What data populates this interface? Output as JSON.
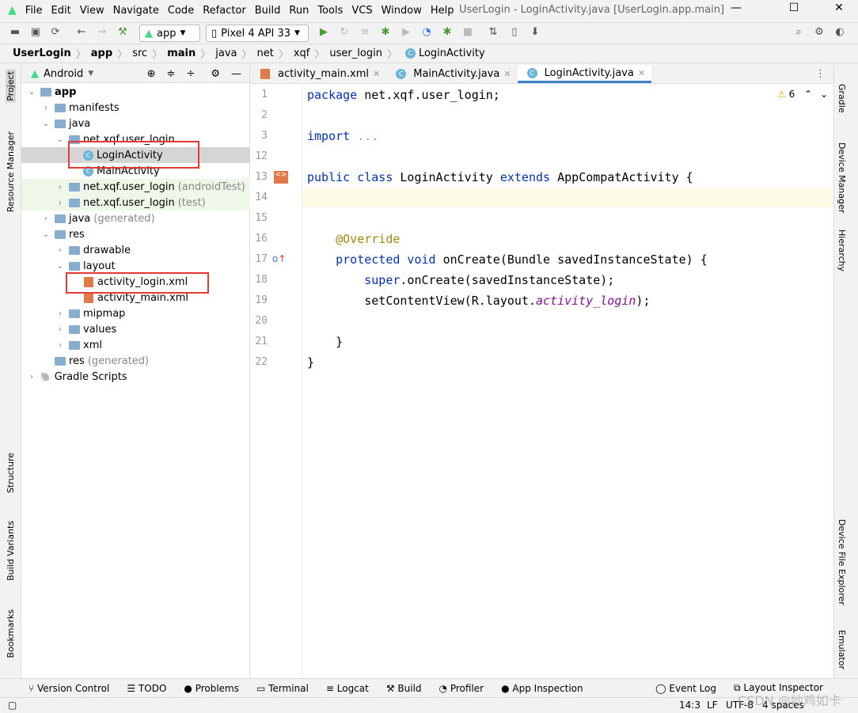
{
  "window": {
    "title": "UserLogin - LoginActivity.java [UserLogin.app.main]"
  },
  "menu": [
    "File",
    "Edit",
    "View",
    "Navigate",
    "Code",
    "Refactor",
    "Build",
    "Run",
    "Tools",
    "VCS",
    "Window",
    "Help"
  ],
  "toolbar": {
    "config": "app",
    "device": "Pixel 4 API 33"
  },
  "breadcrumb": [
    "UserLogin",
    "app",
    "src",
    "main",
    "java",
    "net",
    "xqf",
    "user_login",
    "LoginActivity"
  ],
  "project": {
    "view": "Android",
    "tree": [
      {
        "label": "app",
        "extra": ""
      },
      {
        "label": "manifests",
        "extra": ""
      },
      {
        "label": "java",
        "extra": ""
      },
      {
        "label": "net.xqf.user_login",
        "extra": ""
      },
      {
        "label": "LoginActivity",
        "extra": ""
      },
      {
        "label": "MainActivity",
        "extra": ""
      },
      {
        "label": "net.xqf.user_login",
        "extra": "(androidTest)"
      },
      {
        "label": "net.xqf.user_login",
        "extra": "(test)"
      },
      {
        "label": "java",
        "extra": "(generated)"
      },
      {
        "label": "res",
        "extra": ""
      },
      {
        "label": "drawable",
        "extra": ""
      },
      {
        "label": "layout",
        "extra": ""
      },
      {
        "label": "activity_login.xml",
        "extra": ""
      },
      {
        "label": "activity_main.xml",
        "extra": ""
      },
      {
        "label": "mipmap",
        "extra": ""
      },
      {
        "label": "values",
        "extra": ""
      },
      {
        "label": "xml",
        "extra": ""
      },
      {
        "label": "res",
        "extra": "(generated)"
      },
      {
        "label": "Gradle Scripts",
        "extra": ""
      }
    ]
  },
  "tabs": [
    "activity_main.xml",
    "MainActivity.java",
    "LoginActivity.java"
  ],
  "editor": {
    "warnings": "6",
    "line_numbers": [
      "1",
      "2",
      "3",
      "12",
      "13",
      "14",
      "15",
      "16",
      "17",
      "18",
      "19",
      "20",
      "21",
      "22"
    ],
    "code": {
      "l1a": "package",
      "l1b": " net.xqf.user_login;",
      "l3a": "import",
      "l3b": " ...",
      "l13a": "public class",
      "l13b": " LoginActivity ",
      "l13c": "extends",
      "l13d": " AppCompatActivity {",
      "l16": "    @Override",
      "l17a": "    protected void",
      "l17b": " onCreate(Bundle savedInstanceState) {",
      "l18a": "        super",
      "l18b": ".onCreate(savedInstanceState);",
      "l19a": "        setContentView(R.layout.",
      "l19b": "activity_login",
      "l19c": ");",
      "l21": "    }",
      "l22": "}"
    }
  },
  "left_stripe": [
    "Project",
    "Resource Manager",
    "Structure",
    "Build Variants",
    "Bookmarks"
  ],
  "right_stripe": [
    "Gradle",
    "Device Manager",
    "Hierarchy",
    "Device File Explorer",
    "Emulator"
  ],
  "bottom_tools": [
    "Version Control",
    "TODO",
    "Problems",
    "Terminal",
    "Logcat",
    "Build",
    "Profiler",
    "App Inspection"
  ],
  "bottom_right": [
    "Event Log",
    "Layout Inspector"
  ],
  "status": {
    "position": "14:3",
    "line_sep": "LF",
    "encoding": "UTF-8",
    "indent": "4 spaces"
  },
  "watermark": "CSDN @妙鸡如卡"
}
